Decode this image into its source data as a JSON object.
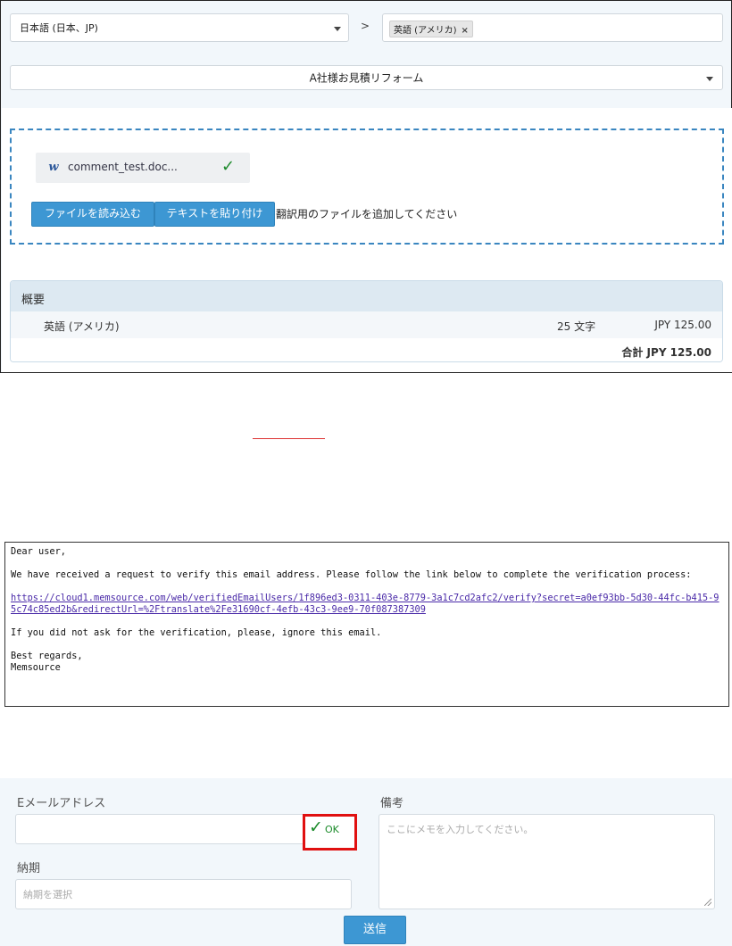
{
  "translation_panel": {
    "source_language": "日本語 (日本、JP)",
    "arrow": ">",
    "target_tag": "英語 (アメリカ)",
    "target_tag_remove": "×",
    "form_template": "A社様お見積リフォーム",
    "file": {
      "name": "comment_test.doc...",
      "status_icon": "check-icon",
      "type_icon": "word-icon"
    },
    "buttons": {
      "load_file": "ファイルを読み込む",
      "paste_text": "テキストを貼り付け"
    },
    "hint": "翻訳用のファイルを追加してください",
    "summary": {
      "title": "概要",
      "rows": [
        {
          "language": "英語 (アメリカ)",
          "count": "25 文字",
          "price": "JPY 125.00"
        }
      ],
      "total": "合計 JPY 125.00"
    }
  },
  "email": {
    "greeting": "Dear user,",
    "body": "We have received a request to verify this email address. Please follow the link below to complete the verification process:",
    "link": "https://cloud1.memsource.com/web/verifiedEmailUsers/1f896ed3-0311-403e-8779-3a1c7cd2afc2/verify?secret=a0ef93bb-5d30-44fc-b415-95c74c85ed2b&redirectUrl=%2Ftranslate%2Fe31690cf-4efb-43c3-9ee9-70f087387309",
    "ignore": "If you did not ask for the verification, please, ignore this email.",
    "closing": "Best regards,",
    "signature": "Memsource"
  },
  "form": {
    "email_label": "Eメールアドレス",
    "ok_label": "OK",
    "deadline_label": "納期",
    "deadline_placeholder": "納期を選択",
    "notes_label": "備考",
    "notes_placeholder": "ここにメモを入力してください。",
    "submit": "送信"
  },
  "colors": {
    "accent": "#3d97d3",
    "ok_green": "#1b8a2a",
    "highlight_red": "#e01010"
  }
}
